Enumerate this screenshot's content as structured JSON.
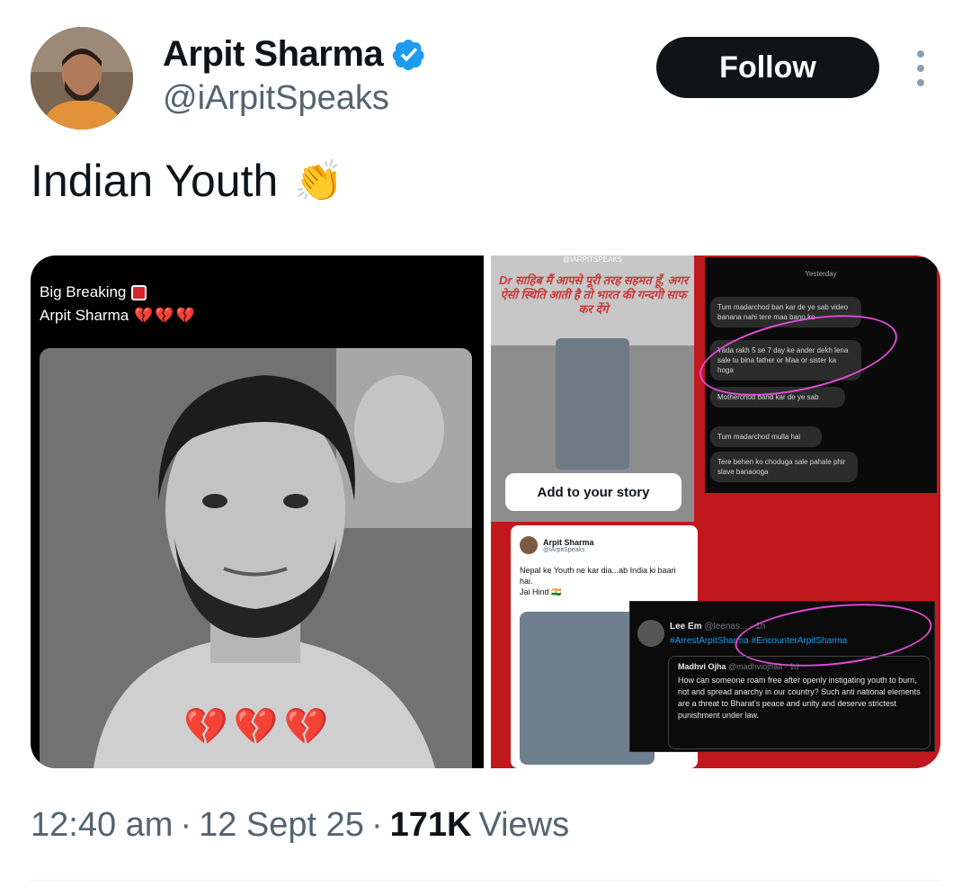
{
  "header": {
    "display_name": "Arpit Sharma",
    "handle": "@iArpitSpeaks",
    "verified": true,
    "follow_label": "Follow",
    "more_icon": "more-vertical-icon"
  },
  "tweet": {
    "text": "Indian Youth",
    "emoji": "👏"
  },
  "media": {
    "left": {
      "line1": "Big Breaking",
      "line2": "Arpit Sharma",
      "line2_emoji": "💔💔💔",
      "bottom_emoji": "💔💔💔"
    },
    "right": {
      "story_header": "@IARPITSPEAKS",
      "story_hindi": "Dr साहिब मैं आपसे पूरी तरह सहमत हूँ, अगर ऐसी स्थिति आती है तो भारत की गन्दगी साफ कर देंगे",
      "story_button": "Add to your story",
      "chat_day": "Yesterday",
      "chat_messages": [
        "Tum madarchod ban kar de ye sab video banana nahi tere maa bano ke",
        "Yada rakh 5 se 7 day ke ander dekh lena sale tu bina father or Maa or sister ka hoga",
        "Motherchod band kar de ye sab",
        "Tum madarchod mulla hai",
        "Tere behen ko choduga sale pahale phir slave banaooga"
      ],
      "embedded_tweet": {
        "name": "Arpit Sharma",
        "handle": "@iArpitSpeaks",
        "body_line1": "Nepal ke Youth ne kar dia...ab India ki baari hai.",
        "body_line2": "Jai Hind 🇮🇳"
      },
      "reply": {
        "name": "Lee Em",
        "handle_time": "@leenas... · 1h",
        "tags": "#ArrestArpitSharma #EncounterArpitSharma",
        "quote_name": "Madhvi Ojha",
        "quote_meta": "@madhviojhaa · 1d",
        "quote_body": "How can someone roam free after openly instigating youth to burn, riot and spread anarchy in our country? Such anti national elements are a threat to Bharat's peace and unity and deserve strictest punishment under law."
      }
    }
  },
  "meta": {
    "time": "12:40 am",
    "sep1": "·",
    "date": "12 Sept 25",
    "sep2": "·",
    "views_count": "171K",
    "views_label": "Views"
  },
  "colors": {
    "verified": "#1d9bf0",
    "follow_bg": "#0f1419",
    "muted": "#536471",
    "collage_red": "#c0181d",
    "highlight_ring": "#e04ad6"
  }
}
